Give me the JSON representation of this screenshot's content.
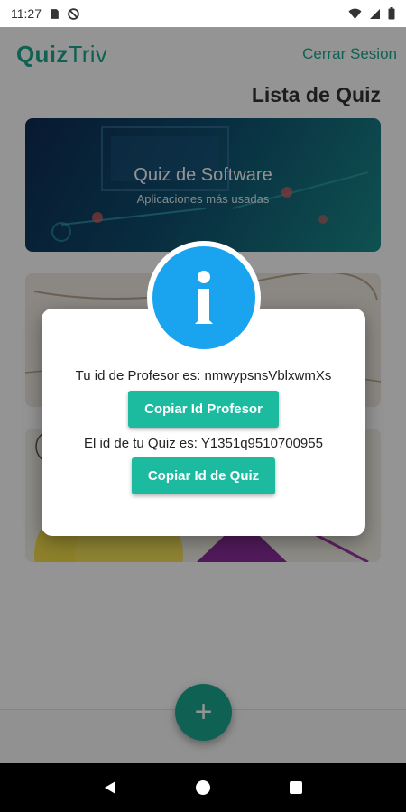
{
  "status_bar": {
    "time": "11:27"
  },
  "app_bar": {
    "logo_bold": "Quiz",
    "logo_light": "Triv",
    "logout_label": "Cerrar Sesion"
  },
  "page_title": "Lista de Quiz",
  "quizzes": [
    {
      "title": "Quiz de Software",
      "subtitle": "Aplicaciones más usadas"
    }
  ],
  "fab_label": "+",
  "dialog": {
    "teacher_id_text": "Tu id de Profesor es: nmwypsnsVblxwmXs",
    "copy_teacher_label": "Copiar Id Profesor",
    "quiz_id_text": "El id de tu Quiz es: Y1351q9510700955",
    "copy_quiz_label": "Copiar Id de Quiz"
  },
  "colors": {
    "accent": "#1aa98f",
    "button": "#1cbba0",
    "info": "#1aa3ee"
  }
}
